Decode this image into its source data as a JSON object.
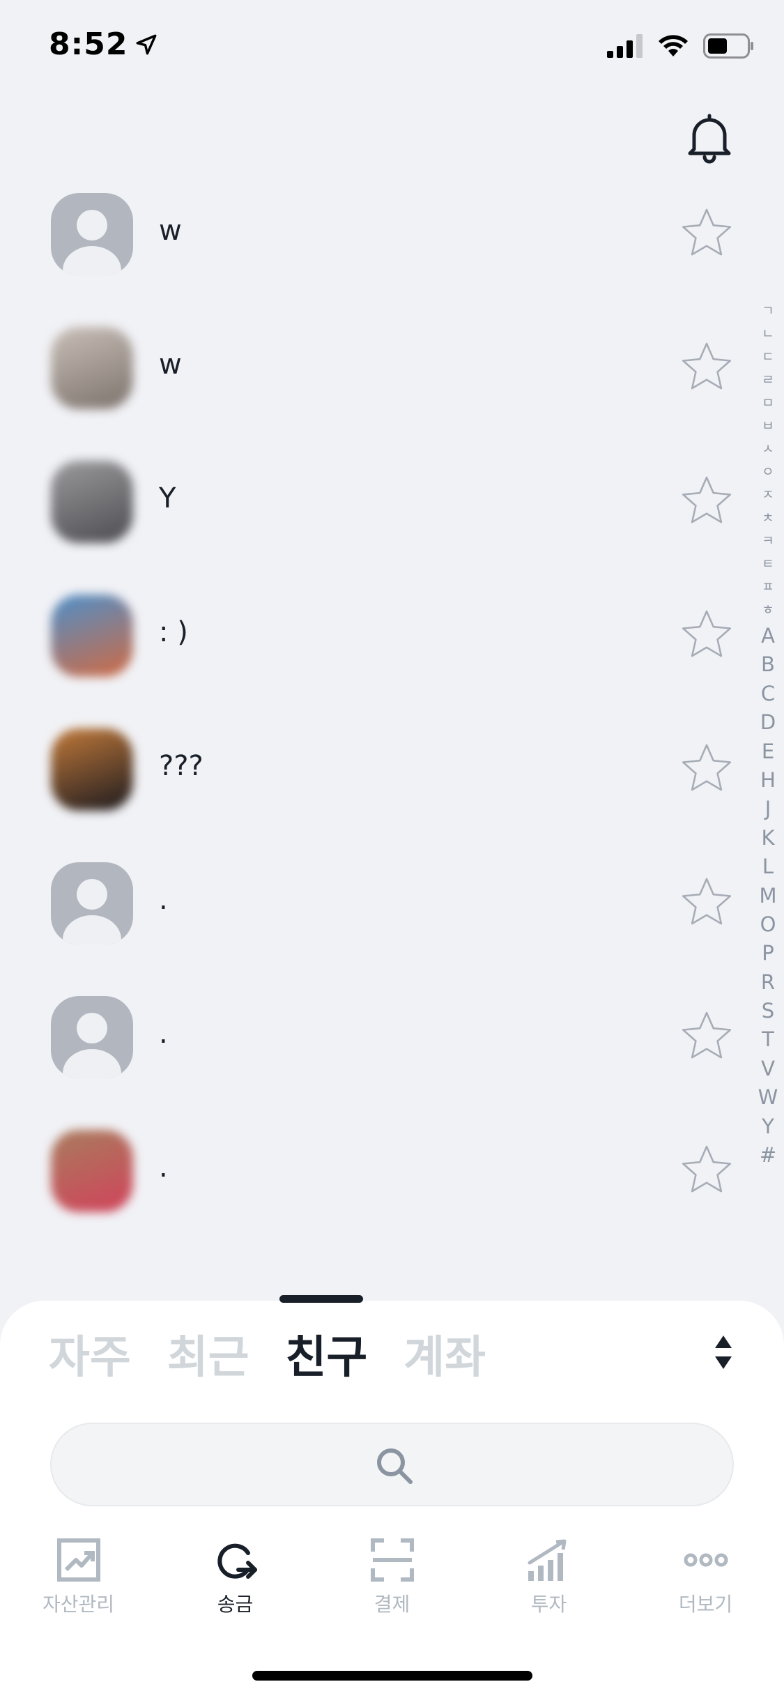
{
  "status_bar": {
    "time": "8:52"
  },
  "header": {
    "notification_icon": "bell-icon"
  },
  "friends": [
    {
      "name": "w",
      "avatar": "default"
    },
    {
      "name": "w",
      "avatar": "photo",
      "colors": [
        "#c9bfb8",
        "#7d736d"
      ]
    },
    {
      "name": "Y",
      "avatar": "photo",
      "colors": [
        "#9a9a9d",
        "#4d4c50"
      ]
    },
    {
      "name": ": )",
      "avatar": "photo",
      "colors": [
        "#4d8fc9",
        "#d06a43"
      ]
    },
    {
      "name": "???",
      "avatar": "photo",
      "colors": [
        "#c27a3a",
        "#1c1a1f"
      ]
    },
    {
      "name": ".",
      "avatar": "default"
    },
    {
      "name": ".",
      "avatar": "default"
    },
    {
      "name": ".",
      "avatar": "photo",
      "colors": [
        "#a87c5d",
        "#d1435b"
      ]
    }
  ],
  "index_bar": {
    "korean": [
      "ㄱ",
      "ㄴ",
      "ㄷ",
      "ㄹ",
      "ㅁ",
      "ㅂ",
      "ㅅ",
      "ㅇ",
      "ㅈ",
      "ㅊ",
      "ㅋ",
      "ㅌ",
      "ㅍ",
      "ㅎ"
    ],
    "latin": [
      "A",
      "B",
      "C",
      "D",
      "E",
      "H",
      "J",
      "K",
      "L",
      "M",
      "O",
      "P",
      "R",
      "S",
      "T",
      "V",
      "W",
      "Y",
      "#"
    ]
  },
  "sheet": {
    "tabs": [
      "자주",
      "최근",
      "친구",
      "계좌"
    ],
    "active_tab": "친구",
    "search": {
      "value": "",
      "placeholder": ""
    }
  },
  "bottom_nav": [
    {
      "label": "자산관리",
      "icon": "chart-icon",
      "active": false
    },
    {
      "label": "송금",
      "icon": "transfer-icon",
      "active": true
    },
    {
      "label": "결제",
      "icon": "scan-icon",
      "active": false
    },
    {
      "label": "투자",
      "icon": "investment-icon",
      "active": false
    },
    {
      "label": "더보기",
      "icon": "more-icon",
      "active": false
    }
  ],
  "colors": {
    "background": "#f1f2f6",
    "text": "#191f28",
    "inactive": "#b0b8c1",
    "tab_inactive": "#d1d6db",
    "avatar_default": "#b2b7bf"
  }
}
